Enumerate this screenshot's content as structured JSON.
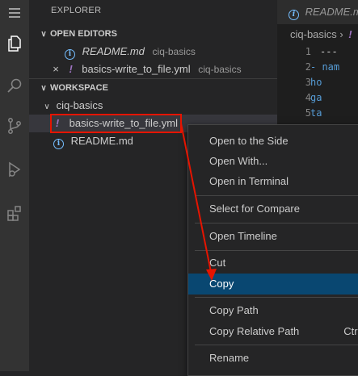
{
  "explorer": {
    "title": "EXPLORER"
  },
  "open_editors": {
    "header": "OPEN EDITORS",
    "items": [
      {
        "name": "README.md",
        "folder": "ciq-basics",
        "icon": "info-icon"
      },
      {
        "name": "basics-write_to_file.yml",
        "folder": "ciq-basics",
        "icon": "yaml-icon",
        "close": "×"
      }
    ]
  },
  "workspace": {
    "header": "WORKSPACE",
    "folder": "ciq-basics",
    "files": [
      {
        "name": "basics-write_to_file.yml",
        "icon": "yaml-icon"
      },
      {
        "name": "README.md",
        "icon": "info-icon"
      }
    ]
  },
  "editor": {
    "tab_label": "README.md",
    "breadcrumb": "ciq-basics",
    "line_numbers": [
      "1",
      "2",
      "3",
      "4",
      "5"
    ],
    "code_lines": [
      "---",
      "- nam",
      "  ho",
      "  ga",
      "  ta"
    ]
  },
  "context_menu": {
    "items": [
      {
        "label": "Open to the Side"
      },
      {
        "label": "Open With..."
      },
      {
        "label": "Open in Terminal"
      },
      {
        "label": "Select for Compare"
      },
      {
        "label": "Open Timeline"
      },
      {
        "label": "Cut"
      },
      {
        "label": "Copy"
      },
      {
        "label": "Copy Path"
      },
      {
        "label": "Copy Relative Path",
        "shortcut": "Ctrl+"
      },
      {
        "label": "Rename"
      }
    ]
  },
  "colors": {
    "accent_highlight": "#094771",
    "annotation": "#e51400",
    "yaml_icon": "#a074c4",
    "info_icon": "#75beff"
  }
}
